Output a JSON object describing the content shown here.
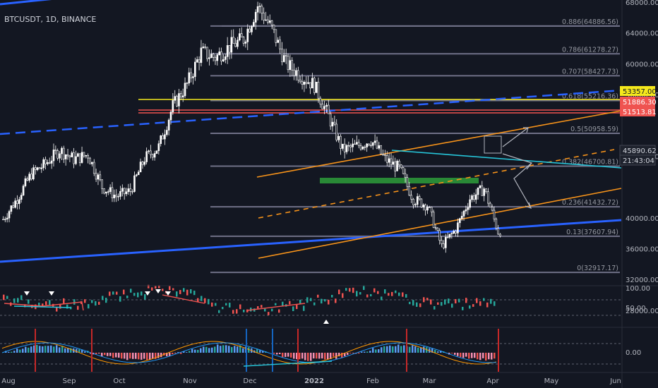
{
  "symbol_line": "BTCUSDT, 1D, BINANCE",
  "colors": {
    "background": "#131722",
    "candle": "#ffffff",
    "fib_line": "#6f7087",
    "blue_line": "#2962ff",
    "orange": "#f7931a",
    "cyan": "#26c6da",
    "green": "#2e9d3a",
    "yellow": "#f5e81c",
    "red": "#ef5350",
    "axis_text": "#b2b5be"
  },
  "chart_data": {
    "type": "candlestick",
    "symbol": "BTCUSDT",
    "interval": "1D",
    "exchange": "BINANCE",
    "x_months": [
      "Aug",
      "Sep",
      "Oct",
      "Nov",
      "Dec",
      "2022",
      "Feb",
      "Mar",
      "Apr",
      "May",
      "Jun"
    ],
    "y_ticks": [
      "68000.00",
      "64000.00",
      "60000.00",
      "56000.00",
      "48000.00",
      "40000.00",
      "36000.00",
      "32000.00",
      "28000.00"
    ],
    "ylim": [
      26000,
      69000
    ],
    "fib_levels": [
      {
        "label": "0.886(64886.56)",
        "value": 64886.56
      },
      {
        "label": "0.786(61278.27)",
        "value": 61278.27
      },
      {
        "label": "0.707(58427.73)",
        "value": 58427.73
      },
      {
        "label": "0.618(55216.36)",
        "value": 55216.36
      },
      {
        "label": "0.5(50958.59)",
        "value": 50958.59
      },
      {
        "label": "0.382(46700.81)",
        "value": 46700.81
      },
      {
        "label": "0.236(41432.72)",
        "value": 41432.72
      },
      {
        "label": "0.13(37607.94)",
        "value": 37607.94
      },
      {
        "label": "0(32917.17)",
        "value": 32917.17
      }
    ],
    "price_badges": [
      {
        "label": "53357.00",
        "color": "yellow"
      },
      {
        "label": "51886.30",
        "color": "red"
      },
      {
        "label": "51513.81",
        "color": "red"
      },
      {
        "label": "45890.62",
        "color": "dark"
      },
      {
        "label": "21:43:04",
        "color": "dark"
      }
    ],
    "weekly_closes": [
      39800,
      42500,
      45700,
      47000,
      48800,
      47600,
      48200,
      44000,
      42800,
      43500,
      47700,
      49200,
      54500,
      57300,
      61500,
      60800,
      62200,
      63200,
      67500,
      64500,
      60000,
      58500,
      57200,
      53200,
      48800,
      49300,
      50100,
      47600,
      46400,
      42400,
      41600,
      36300,
      38500,
      42500,
      43800,
      38200,
      38700,
      39000,
      42000,
      43300,
      40200,
      41800,
      46800,
      45900
    ],
    "rsi_panel": {
      "ticks": [
        "100.00",
        "50.00"
      ]
    },
    "macd_panel": {
      "ticks": [
        "0.00"
      ]
    }
  }
}
